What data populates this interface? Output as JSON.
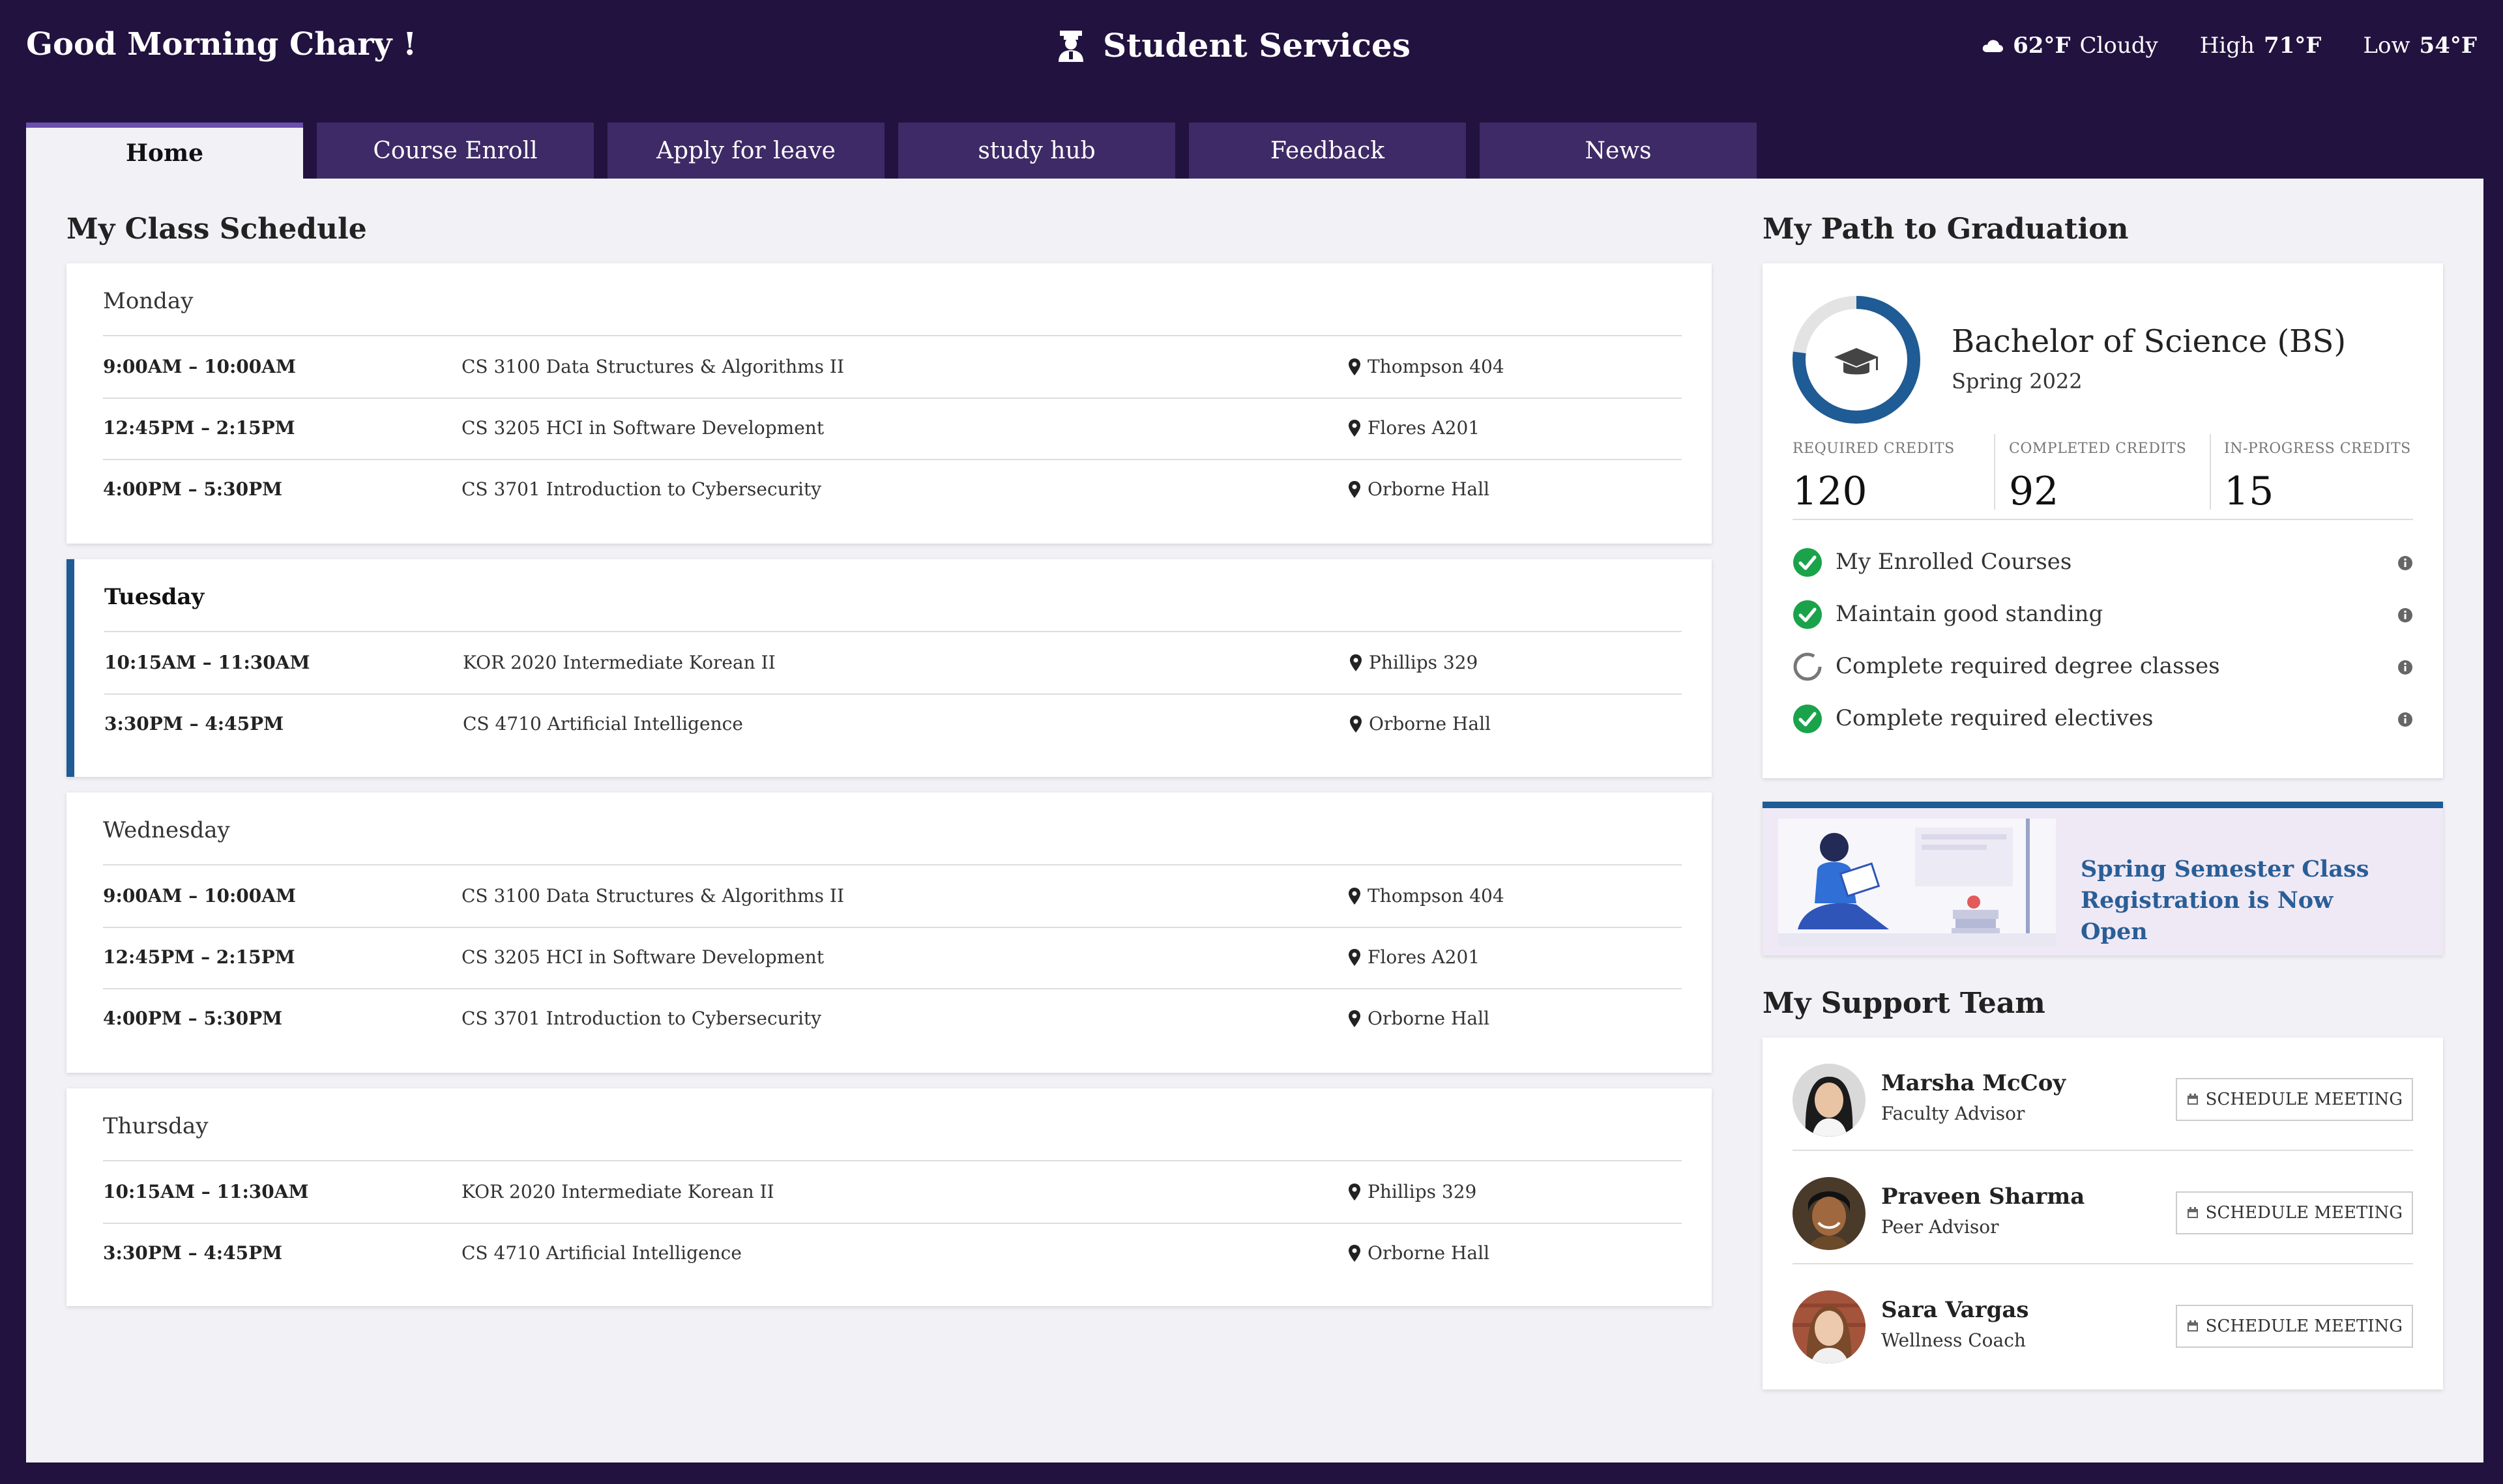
{
  "header": {
    "greeting": "Good Morning Chary !",
    "brand": "Student Services",
    "weather": {
      "current": "62°F",
      "condition": "Cloudy",
      "high_label": "High",
      "high": "71°F",
      "low_label": "Low",
      "low": "54°F"
    }
  },
  "tabs": [
    {
      "label": "Home",
      "active": true
    },
    {
      "label": "Course Enroll"
    },
    {
      "label": "Apply for leave"
    },
    {
      "label": "study hub"
    },
    {
      "label": "Feedback"
    },
    {
      "label": "News"
    }
  ],
  "schedule": {
    "title": "My Class Schedule",
    "days": [
      {
        "name": "Monday",
        "classes": [
          {
            "time": "9:00AM – 10:00AM",
            "course": "CS 3100 Data Structures & Algorithms II",
            "room": "Thompson 404"
          },
          {
            "time": "12:45PM – 2:15PM",
            "course": "CS 3205 HCI in Software Development",
            "room": "Flores A201"
          },
          {
            "time": "4:00PM – 5:30PM",
            "course": "CS 3701 Introduction to Cybersecurity",
            "room": "Orborne Hall"
          }
        ]
      },
      {
        "name": "Tuesday",
        "highlight": true,
        "classes": [
          {
            "time": "10:15AM – 11:30AM",
            "course": "KOR 2020 Intermediate Korean II",
            "room": "Phillips 329"
          },
          {
            "time": "3:30PM – 4:45PM",
            "course": "CS 4710 Artificial Intelligence",
            "room": "Orborne Hall"
          }
        ]
      },
      {
        "name": "Wednesday",
        "classes": [
          {
            "time": "9:00AM – 10:00AM",
            "course": "CS 3100 Data Structures & Algorithms II",
            "room": "Thompson 404"
          },
          {
            "time": "12:45PM – 2:15PM",
            "course": "CS 3205 HCI in Software Development",
            "room": "Flores A201"
          },
          {
            "time": "4:00PM – 5:30PM",
            "course": "CS 3701 Introduction to Cybersecurity",
            "room": "Orborne Hall"
          }
        ]
      },
      {
        "name": "Thursday",
        "classes": [
          {
            "time": "10:15AM – 11:30AM",
            "course": "KOR 2020 Intermediate Korean II",
            "room": "Phillips 329"
          },
          {
            "time": "3:30PM – 4:45PM",
            "course": "CS 4710 Artificial Intelligence",
            "room": "Orborne Hall"
          }
        ]
      }
    ]
  },
  "graduation": {
    "title": "My Path to Graduation",
    "degree": "Bachelor of Science (BS)",
    "term": "Spring 2022",
    "progress_fraction": 0.77,
    "credits": {
      "required_label": "REQUIRED CREDITS",
      "required": "120",
      "completed_label": "COMPLETED CREDITS",
      "completed": "92",
      "inprogress_label": "IN-PROGRESS CREDITS",
      "inprogress": "15"
    },
    "checklist": [
      {
        "label": "My Enrolled Courses",
        "done": true
      },
      {
        "label": "Maintain good standing",
        "done": true
      },
      {
        "label": "Complete required degree classes",
        "done": false
      },
      {
        "label": "Complete required electives",
        "done": true
      }
    ]
  },
  "promo": {
    "text": "Spring Semester Class Registration is Now Open"
  },
  "support": {
    "title": "My Support Team",
    "button_label": "SCHEDULE MEETING",
    "members": [
      {
        "name": "Marsha McCoy",
        "role": "Faculty Advisor"
      },
      {
        "name": "Praveen Sharma",
        "role": "Peer Advisor"
      },
      {
        "name": "Sara Vargas",
        "role": "Wellness Coach"
      }
    ]
  },
  "colors": {
    "background": "#22123f",
    "tab": "#3d2a66",
    "accent": "#1f5b94",
    "check": "#1aa34a",
    "promo_bg": "#efe9f6"
  }
}
